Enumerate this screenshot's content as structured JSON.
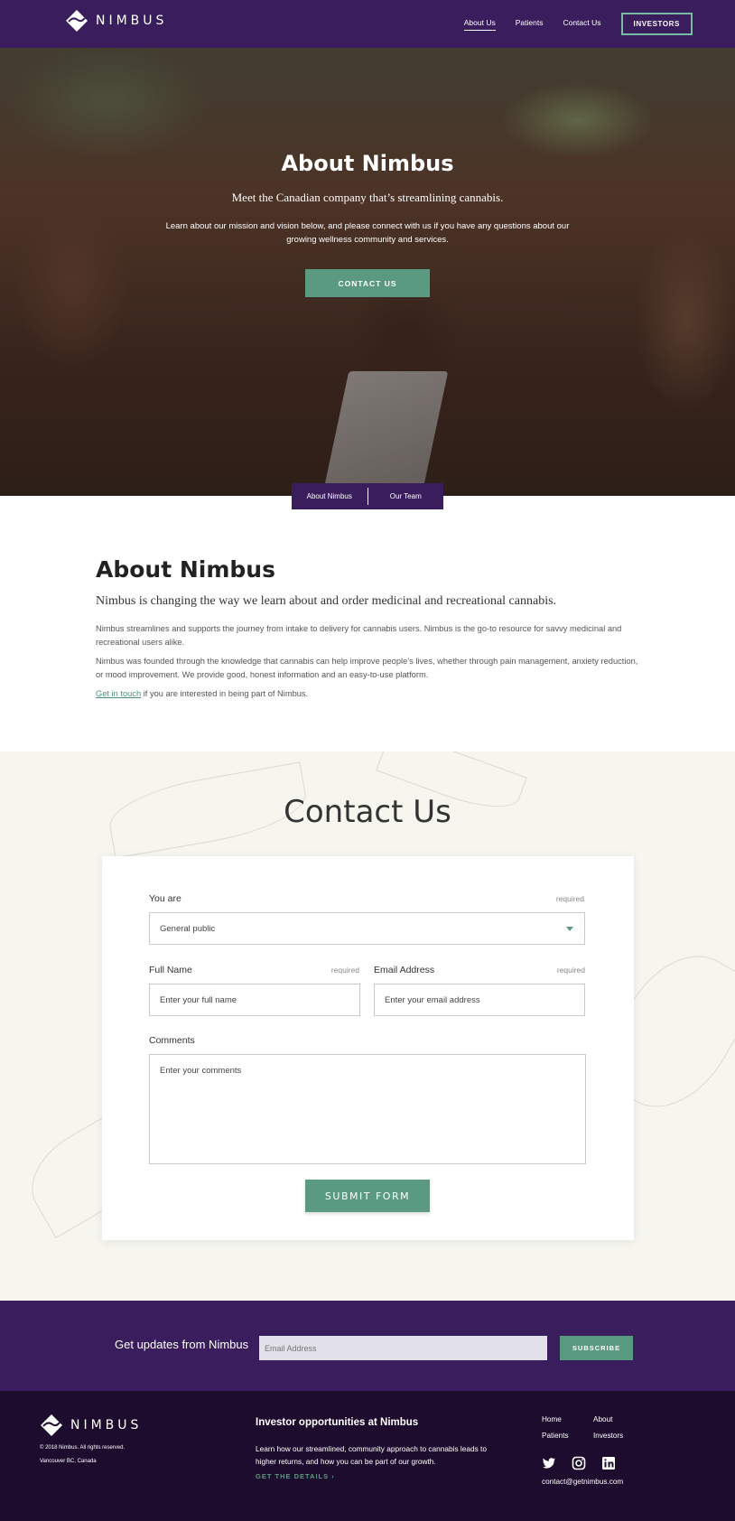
{
  "nav": {
    "brand": "NIMBUS",
    "links": [
      "About Us",
      "Patients",
      "Contact Us"
    ],
    "investors_label": "INVESTORS"
  },
  "hero": {
    "title": "About Nimbus",
    "subtitle": "Meet the Canadian company that’s streamlining cannabis.",
    "description": "Learn about our mission and vision below, and please connect with us if you have any questions about our growing wellness community and services.",
    "cta_label": "CONTACT US",
    "subnav": [
      "About Nimbus",
      "Our Team"
    ]
  },
  "about": {
    "title": "About Nimbus",
    "lead": "Nimbus is changing the way we learn about and order medicinal and recreational cannabis.",
    "p1": "Nimbus streamlines and supports the journey from intake to delivery for cannabis users. Nimbus is the go-to resource for savvy medicinal and recreational users alike.",
    "p2": "Nimbus was founded through the knowledge that cannabis can help improve people’s lives, whether through pain management, anxiety reduction, or mood improvement. We provide good, honest information and an easy-to-use platform.",
    "p3_link": "Get in touch",
    "p3_rest": " if you are interested in being part of Nimbus."
  },
  "contact": {
    "title": "Contact Us",
    "you_are_label": "You are",
    "you_are_value": "General public",
    "name_label": "Full Name",
    "name_placeholder": "Enter your full name",
    "email_label": "Email Address",
    "email_placeholder": "Enter your email address",
    "comments_label": "Comments",
    "comments_placeholder": "Enter your comments",
    "required": "required",
    "submit_label": "SUBMIT FORM"
  },
  "newsletter": {
    "label": "Get updates from Nimbus",
    "placeholder": "Email Address",
    "button": "SUBSCRIBE"
  },
  "footer": {
    "brand": "NIMBUS",
    "copyright": "© 2018 Nimbus. All rights reserved.",
    "location": "Vancouver BC, Canada",
    "investor_heading": "Investor opportunities at Nimbus",
    "investor_text": "Learn how our streamlined, community approach to cannabis leads to higher returns, and how you can be part of our growth.",
    "details_label": "GET THE DETAILS",
    "links": [
      "Home",
      "About",
      "Patients",
      "Investors"
    ],
    "email": "contact@getnimbus.com",
    "social_icons": [
      "twitter-icon",
      "instagram-icon",
      "linkedin-icon"
    ]
  },
  "colors": {
    "brand_purple": "#3a1d5c",
    "accent_green": "#5a9a80",
    "footer_dark": "#1e0c2e",
    "contact_bg": "#f6f6ef"
  }
}
